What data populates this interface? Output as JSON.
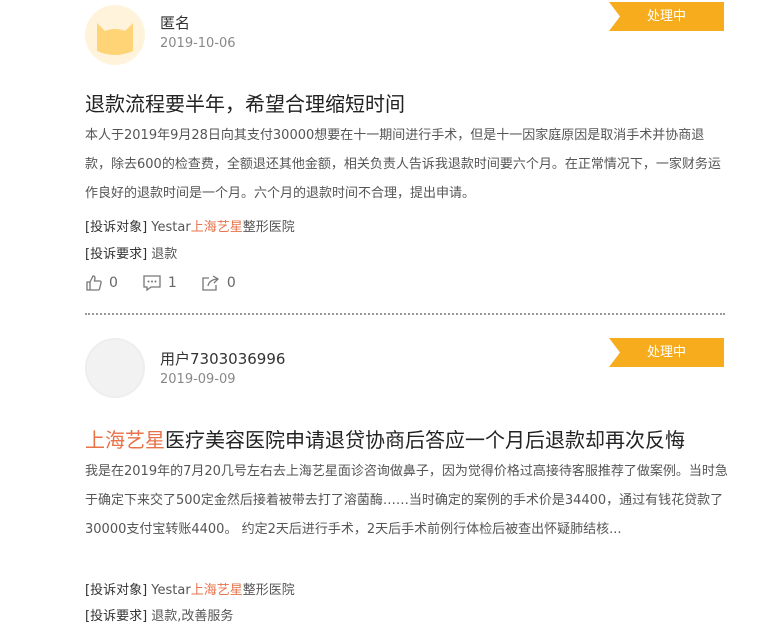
{
  "posts": [
    {
      "user": "匿名",
      "date": "2019-10-06",
      "status": "处理中",
      "avatar_icon": "cat-avatar-icon",
      "title": "退款流程要半年，希望合理缩短时间",
      "body": "本人于2019年9月28日向其支付30000想要在十一期间进行手术，但是十一因家庭原因是取消手术并协商退款，除去600的检查费，全额退还其他金额，相关负责人告诉我退款时间要六个月。在正常情况下，一家财务运作良好的退款时间是一个月。六个月的退款时间不合理，提出申请。",
      "target_label": "[投诉对象]",
      "target_prefix": "Yestar",
      "target_highlight": "上海艺星",
      "target_suffix": "整形医院",
      "demand_label": "[投诉要求]",
      "demand_value": "退款",
      "likes": "0",
      "comments": "1",
      "shares": "0"
    },
    {
      "user": "用户7303036996",
      "date": "2019-09-09",
      "status": "处理中",
      "avatar_icon": "default-avatar-icon",
      "title_highlight": "上海艺星",
      "title_rest": "医疗美容医院申请退贷协商后答应一个月后退款却再次反悔",
      "body": "我是在2019年的7月20几号左右去上海艺星面诊咨询做鼻子，因为觉得价格过高接待客服推荐了做案例。当时急于确定下来交了500定金然后接着被带去打了溶菌酶……当时确定的案例的手术价是34400，通过有钱花贷款了30000支付宝转账4400。 约定2天后进行手术，2天后手术前例行体检后被查出怀疑肺结核...",
      "target_label": "[投诉对象]",
      "target_prefix": "Yestar",
      "target_highlight": "上海艺星",
      "target_suffix": "整形医院",
      "demand_label": "[投诉要求]",
      "demand_value": "退款,改善服务"
    }
  ],
  "colors": {
    "badge": "#f6ac1d",
    "highlight": "#e8734a"
  }
}
